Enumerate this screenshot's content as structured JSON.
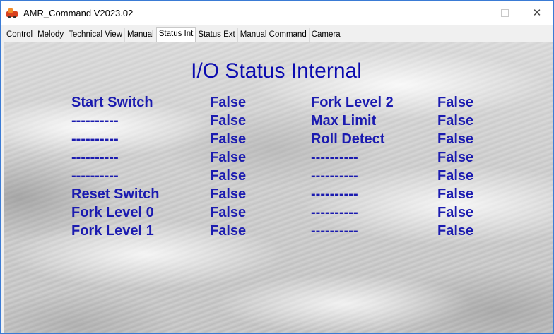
{
  "window": {
    "title": "AMR_Command V2023.02",
    "minimize": "",
    "maximize": "",
    "close": "✕"
  },
  "tabs": [
    "Control",
    "Melody",
    "Technical View",
    "Manual",
    "Status Int",
    "Status Ext",
    "Manual Command",
    "Camera"
  ],
  "active_tab": "Status Int",
  "panel": {
    "heading": "I/O Status Internal",
    "left_column": [
      {
        "label": "Start Switch",
        "value": "False"
      },
      {
        "label": "----------",
        "value": "False"
      },
      {
        "label": "----------",
        "value": "False"
      },
      {
        "label": "----------",
        "value": "False"
      },
      {
        "label": "----------",
        "value": "False"
      },
      {
        "label": "Reset Switch",
        "value": "False"
      },
      {
        "label": "Fork Level 0",
        "value": "False"
      },
      {
        "label": "Fork Level 1",
        "value": "False"
      }
    ],
    "right_column": [
      {
        "label": "Fork Level 2",
        "value": "False"
      },
      {
        "label": "Max Limit",
        "value": "False"
      },
      {
        "label": "Roll Detect",
        "value": "False"
      },
      {
        "label": "----------",
        "value": "False"
      },
      {
        "label": "----------",
        "value": "False"
      },
      {
        "label": "----------",
        "value": "False"
      },
      {
        "label": "----------",
        "value": "False"
      },
      {
        "label": "----------",
        "value": "False"
      }
    ]
  },
  "colors": {
    "text": "#1b1bb0",
    "heading": "#0b0bb0"
  }
}
